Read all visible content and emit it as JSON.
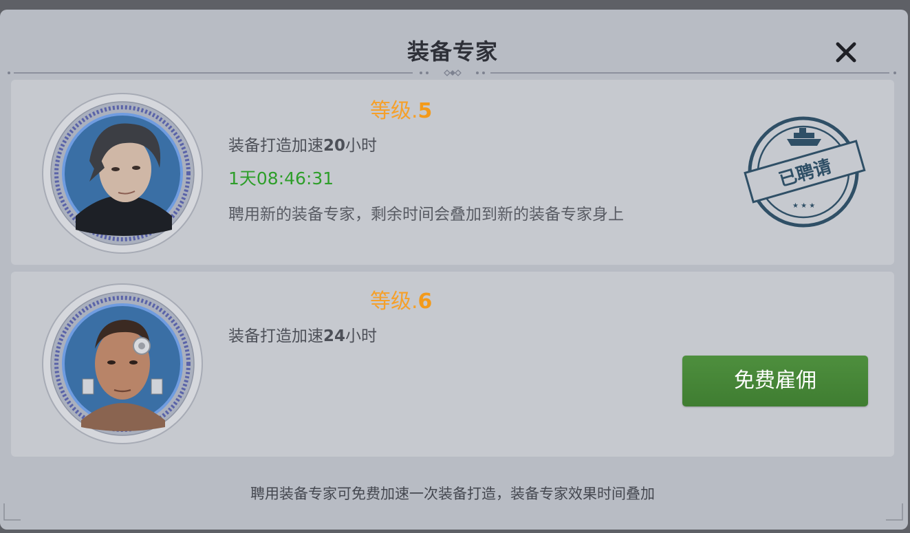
{
  "dialog": {
    "title": "装备专家",
    "footer": "聘用装备专家可免费加速一次装备打造，装备专家效果时间叠加"
  },
  "experts": [
    {
      "level_label": "等级.",
      "level_value": "5",
      "desc_prefix": "装备打造加速",
      "desc_hours": "20",
      "desc_suffix": "小时",
      "timer": "1天08:46:31",
      "note": "聘用新的装备专家，剩余时间会叠加到新的装备专家身上",
      "stamp_text": "已聘请"
    },
    {
      "level_label": "等级.",
      "level_value": "6",
      "desc_prefix": "装备打造加速",
      "desc_hours": "24",
      "desc_suffix": "小时",
      "button": "免费雇佣"
    }
  ],
  "colors": {
    "level": "#f5a02a",
    "timer": "#2e9e2a",
    "button": "#4a8a3b",
    "stamp": "#2f4f66"
  },
  "icons": [
    "close-icon",
    "hired-stamp-icon",
    "ship-icon"
  ]
}
